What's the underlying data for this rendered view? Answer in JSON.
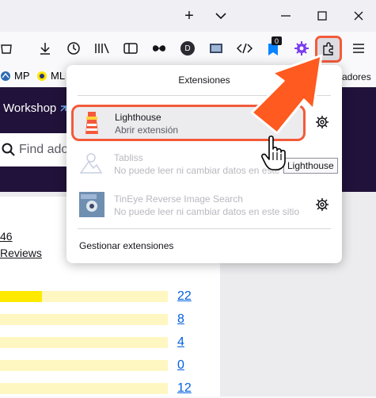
{
  "browser": {
    "accent_color": "#f35a3a",
    "titlebar": {
      "new_tab": "+",
      "tab_list": "⌄"
    },
    "toolbar": {
      "icons": [
        "library-icon",
        "download-icon",
        "history-icon",
        "bookmarks-icon",
        "sidebar-icon",
        "mask-icon",
        "profile-icon",
        "screenshot-icon",
        "devtools-icon",
        "badge-icon",
        "gear-ext-icon",
        "extensions-icon",
        "menu-icon"
      ],
      "profile_initial": "D",
      "badge_count": "0"
    },
    "bookmarks": [
      {
        "label": "MP"
      },
      {
        "label": "ML"
      },
      {
        "label": "adores"
      }
    ]
  },
  "page": {
    "workshop_label": "Workshop",
    "search_placeholder": "Find ado",
    "reviews_count": "46",
    "reviews_label": "Reviews",
    "rating_bars": [
      {
        "count": "22",
        "fraction": 0.25
      },
      {
        "count": "8",
        "fraction": 0.0
      },
      {
        "count": "4",
        "fraction": 0.0
      },
      {
        "count": "0",
        "fraction": 0.0
      },
      {
        "count": "12",
        "fraction": 0.0
      }
    ]
  },
  "extensions_panel": {
    "title": "Extensiones",
    "items": [
      {
        "name": "Lighthouse",
        "subtitle": "Abrir extensión",
        "enabled": true,
        "icon": "lighthouse-icon"
      },
      {
        "name": "Tabliss",
        "subtitle": "No puede leer ni cambiar datos en este sitio",
        "enabled": false,
        "icon": "tabliss-icon"
      },
      {
        "name": "TinEye Reverse Image Search",
        "subtitle": "No puede leer ni cambiar datos en este sitio",
        "enabled": false,
        "icon": "tineye-icon"
      }
    ],
    "manage_label": "Gestionar extensiones",
    "tooltip": "Lighthouse"
  }
}
